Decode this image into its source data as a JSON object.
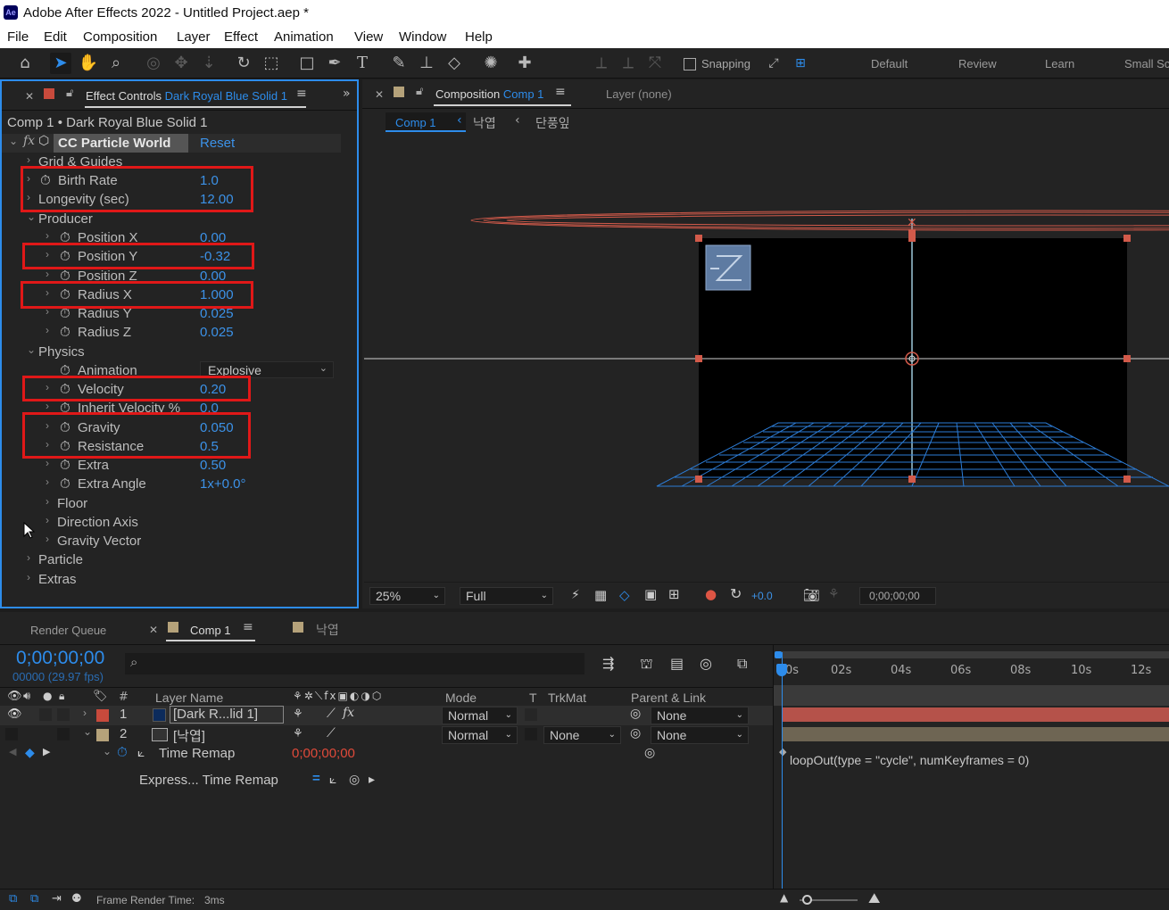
{
  "window": {
    "app_icon": "Ae",
    "title": "Adobe After Effects 2022 - Untitled Project.aep *"
  },
  "menu": [
    "File",
    "Edit",
    "Composition",
    "Layer",
    "Effect",
    "Animation",
    "View",
    "Window",
    "Help"
  ],
  "toolbar": {
    "snapping_label": "Snapping",
    "workspaces": [
      "Default",
      "Review",
      "Learn",
      "Small Sc"
    ]
  },
  "effect_controls": {
    "tab_label": "Effect Controls",
    "tab_layer": "Dark Royal Blue Solid 1",
    "breadcrumb": "Comp 1 • Dark Royal Blue Solid 1",
    "effect_name": "CC Particle World",
    "reset_label": "Reset",
    "properties": [
      {
        "label": "Grid & Guides",
        "value": ""
      },
      {
        "label": "Birth Rate",
        "value": "1.0"
      },
      {
        "label": "Longevity (sec)",
        "value": "12.00"
      },
      {
        "label": "Producer",
        "value": ""
      },
      {
        "label": "Position X",
        "value": "0.00"
      },
      {
        "label": "Position Y",
        "value": "-0.32"
      },
      {
        "label": "Position Z",
        "value": "0.00"
      },
      {
        "label": "Radius X",
        "value": "1.000"
      },
      {
        "label": "Radius Y",
        "value": "0.025"
      },
      {
        "label": "Radius Z",
        "value": "0.025"
      },
      {
        "label": "Physics",
        "value": ""
      },
      {
        "label": "Animation",
        "value": "Explosive"
      },
      {
        "label": "Velocity",
        "value": "0.20"
      },
      {
        "label": "Inherit Velocity %",
        "value": "0.0"
      },
      {
        "label": "Gravity",
        "value": "0.050"
      },
      {
        "label": "Resistance",
        "value": "0.5"
      },
      {
        "label": "Extra",
        "value": "0.50"
      },
      {
        "label": "Extra Angle",
        "value": "1x+0.0°"
      },
      {
        "label": "Floor",
        "value": ""
      },
      {
        "label": "Direction Axis",
        "value": ""
      },
      {
        "label": "Gravity Vector",
        "value": ""
      },
      {
        "label": "Particle",
        "value": ""
      },
      {
        "label": "Extras",
        "value": ""
      }
    ]
  },
  "composition": {
    "tab_label": "Composition",
    "tab_comp": "Comp 1",
    "layer_tab": "Layer (none)",
    "crumbs": [
      "Comp 1",
      "낙엽",
      "단풍잎"
    ],
    "zoom": "25%",
    "resolution": "Full",
    "exposure": "+0.0",
    "timecode": "0;00;00;00"
  },
  "timeline": {
    "render_queue_tab": "Render Queue",
    "comp_tab": "Comp 1",
    "other_tab": "낙엽",
    "current_time": "0;00;00;00",
    "fps": "00000 (29.97 fps)",
    "columns": {
      "num": "#",
      "layer_name": "Layer Name",
      "mode": "Mode",
      "t": "T",
      "trkmat": "TrkMat",
      "parent": "Parent & Link"
    },
    "ruler": [
      "0s",
      "02s",
      "04s",
      "06s",
      "08s",
      "10s",
      "12s"
    ],
    "layers": [
      {
        "num": "1",
        "name": "[Dark R...lid 1]",
        "mode": "Normal",
        "trkmat": "",
        "parent": "None",
        "color": "#c84a3c"
      },
      {
        "num": "2",
        "name": "[낙엽]",
        "mode": "Normal",
        "trkmat": "None",
        "parent": "None",
        "color": "#b5a27a"
      }
    ],
    "time_remap_label": "Time Remap",
    "time_remap_value": "0;00;00;00",
    "expression_label": "Express... Time Remap",
    "expression_code": "loopOut(type = \"cycle\", numKeyframes = 0)"
  },
  "status": {
    "label": "Frame Render Time:",
    "value": "3ms"
  }
}
